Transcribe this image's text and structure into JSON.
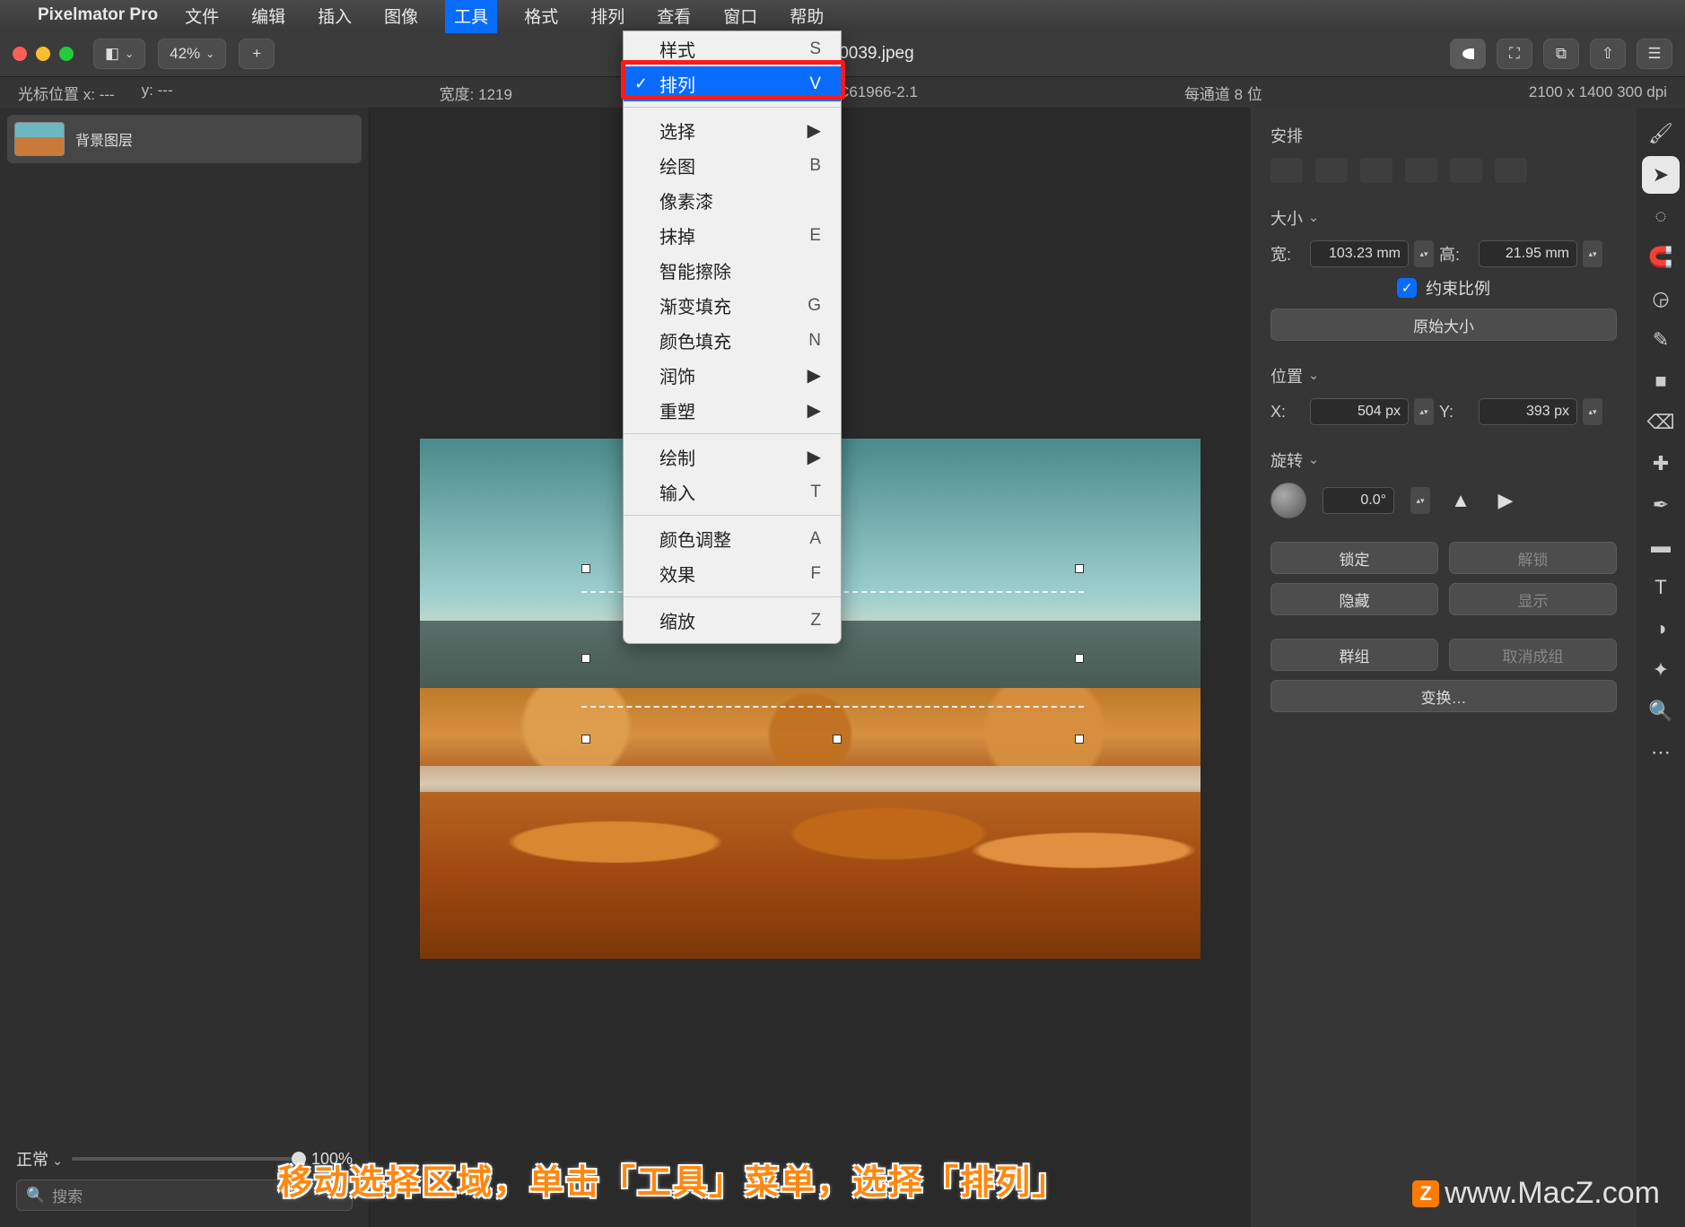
{
  "menubar": {
    "app_name": "Pixelmator Pro",
    "items": [
      "文件",
      "编辑",
      "插入",
      "图像",
      "工具",
      "格式",
      "排列",
      "查看",
      "窗口",
      "帮助"
    ],
    "active_index": 4
  },
  "toolbar": {
    "zoom": "42%",
    "filename": "5330039.jpeg"
  },
  "infobar": {
    "cursor_label": "光标位置 x:",
    "cursor_x": "---",
    "cursor_y_label": "y:",
    "cursor_y": "---",
    "width_label": "宽度:",
    "width_val": "1219",
    "colorspace": "sRGB IEC61966-2.1",
    "channel": "每通道 8 位",
    "dims": "2100 x 1400 300 dpi"
  },
  "layers": {
    "item_name": "背景图层",
    "blend_mode": "正常",
    "opacity": "100%",
    "search_placeholder": "搜索"
  },
  "dropdown": {
    "groups": [
      [
        {
          "label": "样式",
          "shortcut": "S"
        },
        {
          "label": "排列",
          "shortcut": "V",
          "selected": true,
          "checked": true
        }
      ],
      [
        {
          "label": "选择",
          "submenu": true
        },
        {
          "label": "绘图",
          "shortcut": "B"
        },
        {
          "label": "像素漆"
        },
        {
          "label": "抹掉",
          "shortcut": "E"
        },
        {
          "label": "智能擦除"
        },
        {
          "label": "渐变填充",
          "shortcut": "G"
        },
        {
          "label": "颜色填充",
          "shortcut": "N"
        },
        {
          "label": "润饰",
          "submenu": true
        },
        {
          "label": "重塑",
          "submenu": true
        }
      ],
      [
        {
          "label": "绘制",
          "submenu": true
        },
        {
          "label": "输入",
          "shortcut": "T"
        }
      ],
      [
        {
          "label": "颜色调整",
          "shortcut": "A"
        },
        {
          "label": "效果",
          "shortcut": "F"
        }
      ],
      [
        {
          "label": "缩放",
          "shortcut": "Z"
        }
      ]
    ]
  },
  "inspector": {
    "arrange_title": "安排",
    "size_title": "大小",
    "width_label": "宽:",
    "width_val": "103.23 mm",
    "height_label": "高:",
    "height_val": "21.95 mm",
    "constrain_label": "约束比例",
    "original_btn": "原始大小",
    "position_title": "位置",
    "x_label": "X:",
    "x_val": "504 px",
    "y_label": "Y:",
    "y_val": "393 px",
    "rotate_title": "旋转",
    "angle": "0.0°",
    "lock": "锁定",
    "unlock": "解锁",
    "hide": "隐藏",
    "show": "显示",
    "group": "群组",
    "ungroup": "取消成组",
    "transform": "变换…"
  },
  "caption": "移动选择区域，单击「工具」菜单，选择「排列」",
  "watermark": "www.MacZ.com"
}
